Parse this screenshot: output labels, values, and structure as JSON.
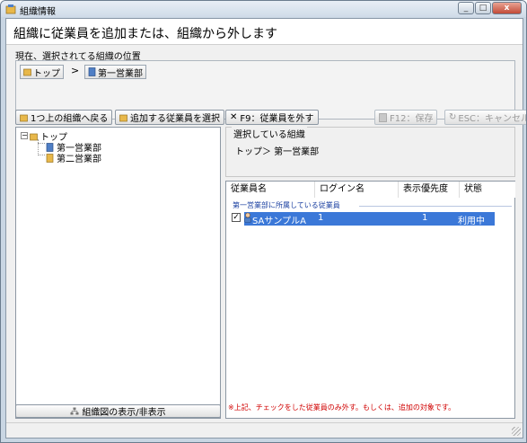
{
  "window": {
    "title": "組織情報",
    "close_symbol": "x",
    "min_symbol": "_",
    "max_symbol": "□"
  },
  "header": {
    "text": "組織に従業員を追加または、組織から外します"
  },
  "location": {
    "label": "現在、選択されてる組織の位置",
    "crumbs": [
      "トップ",
      "第一営業部"
    ],
    "separator": ">"
  },
  "toolbar": {
    "up_label": "1つ上の組織へ戻る",
    "select_label": "追加する従業員を選択",
    "remove_label": "F9：従業員を外す",
    "save_label": "F12：保存",
    "cancel_label": "ESC：キャンセル"
  },
  "tree": {
    "root": "トップ",
    "children": [
      "第一営業部",
      "第二営業部"
    ],
    "expander_symbol": "−"
  },
  "selected_group": {
    "legend": "選択している組織",
    "path": "トップ＞ 第一営業部"
  },
  "employees": {
    "columns": [
      "従業員名",
      "ログイン名",
      "表示優先度",
      "状態"
    ],
    "group_caption": "第一営業部に所属している従業員",
    "rows": [
      {
        "name": "SAサンプルA",
        "login": "1",
        "priority": "1",
        "status": "利用中",
        "checked": true
      }
    ],
    "check_mark": "✓"
  },
  "bottom": {
    "toggle_label": "組織図の表示/非表示",
    "note": "※上記、チェックをした従業員のみ外す。もしくは、追加の対象です。"
  },
  "colors": {
    "selection": "#3b78d8",
    "note": "#d00000",
    "caption": "#1a3fa0",
    "folder": "#e8b84a"
  }
}
